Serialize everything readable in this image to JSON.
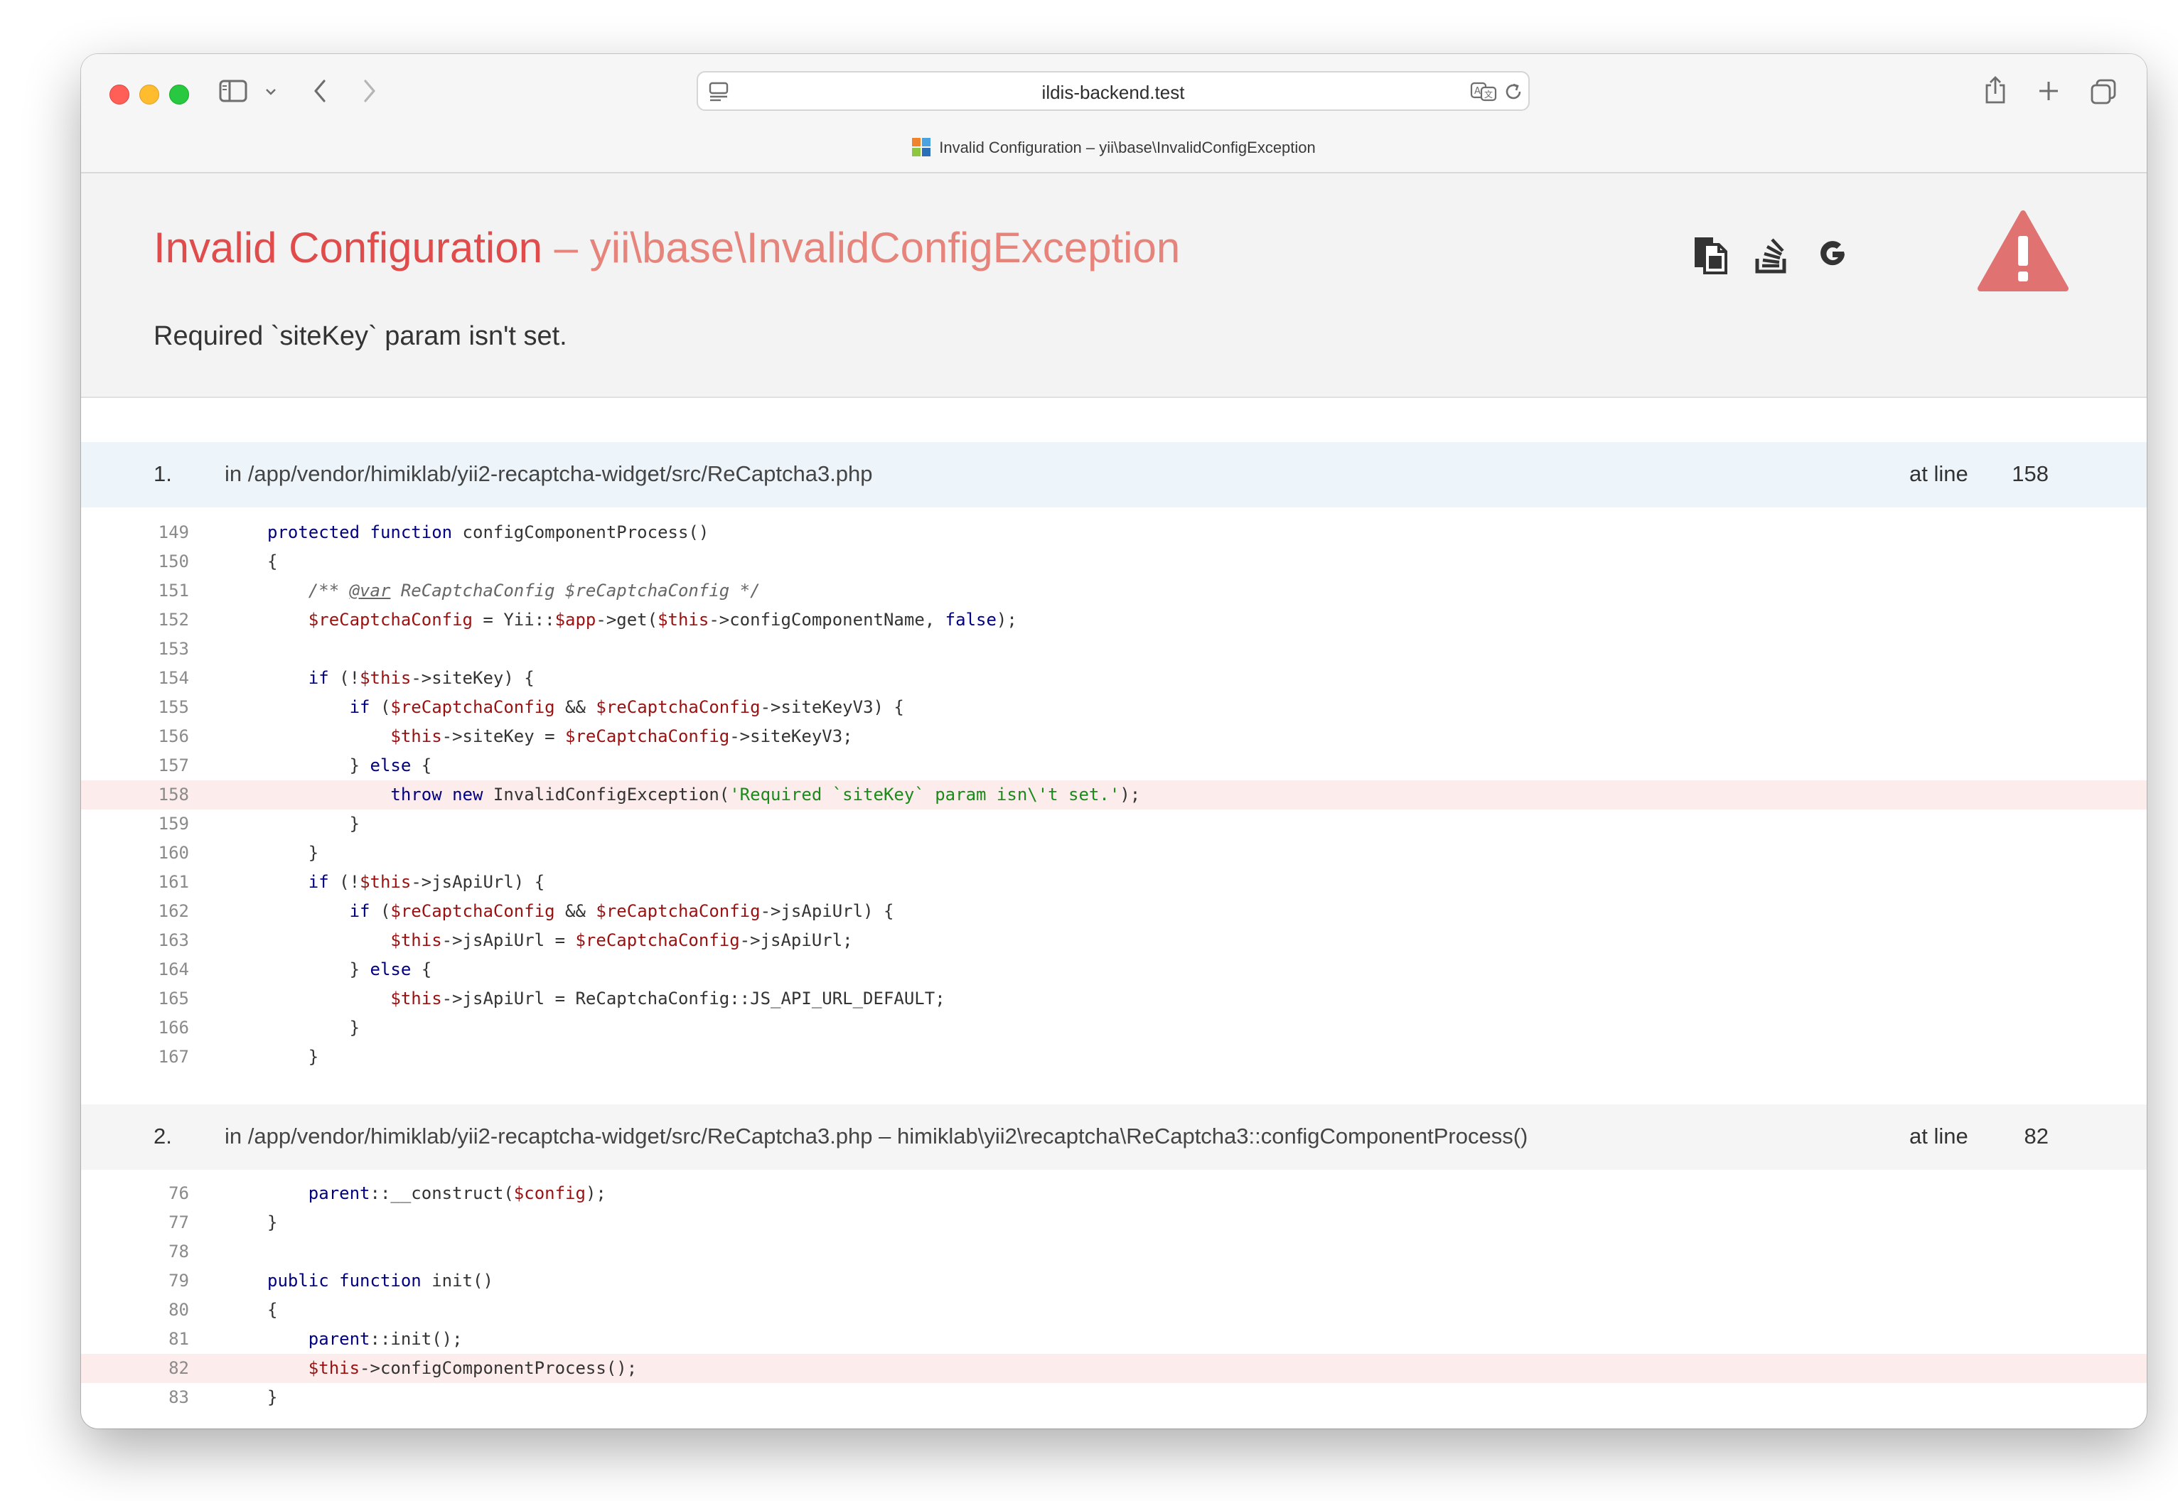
{
  "browser": {
    "url": "ildis-backend.test",
    "tab_title": "Invalid Configuration – yii\\base\\InvalidConfigException"
  },
  "error": {
    "name": "Invalid Configuration",
    "separator": " – ",
    "class": "yii\\base\\InvalidConfigException",
    "message": "Required `siteKey` param isn't set.",
    "accent_color": "#e04c4c"
  },
  "header_icons": [
    "copy-icon",
    "stack-overflow-icon",
    "google-icon",
    "warning-icon"
  ],
  "frames": [
    {
      "number": "1.",
      "location": "in /app/vendor/himiklab/yii2-recaptcha-widget/src/ReCaptcha3.php",
      "at_label": "at line",
      "line": "158",
      "highlight": "158"
    },
    {
      "number": "2.",
      "location": "in /app/vendor/himiklab/yii2-recaptcha-widget/src/ReCaptcha3.php – himiklab\\yii2\\recaptcha\\ReCaptcha3::configComponentProcess()",
      "at_label": "at line",
      "line": "82",
      "highlight": "82"
    }
  ],
  "code": {
    "frame1": [
      {
        "n": "149",
        "t": "protected function configComponentProcess()"
      },
      {
        "n": "150",
        "t": "{"
      },
      {
        "n": "151",
        "t": "    /** @var ReCaptchaConfig $reCaptchaConfig */"
      },
      {
        "n": "152",
        "t": "    $reCaptchaConfig = Yii::$app->get($this->configComponentName, false);"
      },
      {
        "n": "153",
        "t": ""
      },
      {
        "n": "154",
        "t": "    if (!$this->siteKey) {"
      },
      {
        "n": "155",
        "t": "        if ($reCaptchaConfig && $reCaptchaConfig->siteKeyV3) {"
      },
      {
        "n": "156",
        "t": "            $this->siteKey = $reCaptchaConfig->siteKeyV3;"
      },
      {
        "n": "157",
        "t": "        } else {"
      },
      {
        "n": "158",
        "t": "            throw new InvalidConfigException('Required `siteKey` param isn\\'t set.');"
      },
      {
        "n": "159",
        "t": "        }"
      },
      {
        "n": "160",
        "t": "    }"
      },
      {
        "n": "161",
        "t": "    if (!$this->jsApiUrl) {"
      },
      {
        "n": "162",
        "t": "        if ($reCaptchaConfig && $reCaptchaConfig->jsApiUrl) {"
      },
      {
        "n": "163",
        "t": "            $this->jsApiUrl = $reCaptchaConfig->jsApiUrl;"
      },
      {
        "n": "164",
        "t": "        } else {"
      },
      {
        "n": "165",
        "t": "            $this->jsApiUrl = ReCaptchaConfig::JS_API_URL_DEFAULT;"
      },
      {
        "n": "166",
        "t": "        }"
      },
      {
        "n": "167",
        "t": "    }"
      }
    ],
    "frame2": [
      {
        "n": "76",
        "t": "    parent::__construct($config);"
      },
      {
        "n": "77",
        "t": "}"
      },
      {
        "n": "78",
        "t": ""
      },
      {
        "n": "79",
        "t": "public function init()"
      },
      {
        "n": "80",
        "t": "{"
      },
      {
        "n": "81",
        "t": "    parent::init();"
      },
      {
        "n": "82",
        "t": "    $this->configComponentProcess();"
      },
      {
        "n": "83",
        "t": "}"
      }
    ]
  }
}
